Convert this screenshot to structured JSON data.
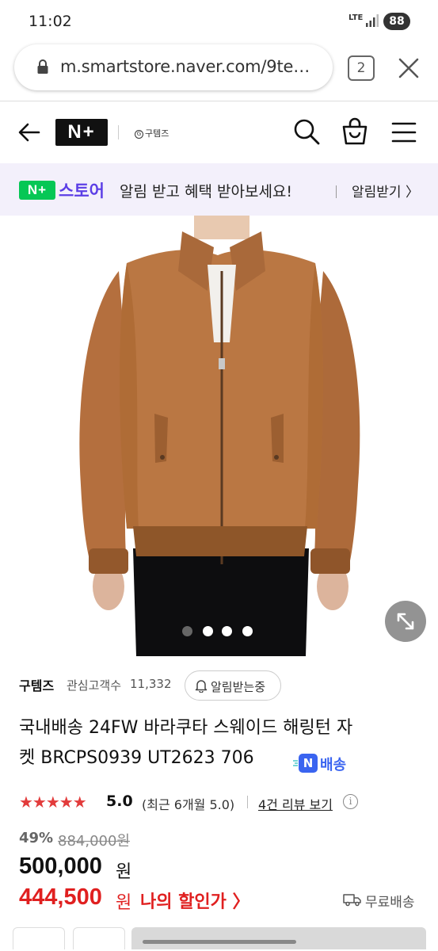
{
  "status_bar": {
    "time": "11:02",
    "network": "LTE",
    "battery": "88"
  },
  "browser": {
    "url": "m.smartstore.naver.com/9te…",
    "tab_count": "2"
  },
  "header": {
    "logo": "N+",
    "brand": "구템즈"
  },
  "banner": {
    "badge": "N+",
    "store_label": "스토어",
    "message": "알림 받고 혜택 받아보세요!",
    "cta": "알림받기 〉"
  },
  "gallery": {
    "active_dot": 0,
    "dot_count": 4,
    "colors": {
      "dot_active": "#555555",
      "dot_inactive": "#ffffff",
      "jacket": "#b26e3d"
    }
  },
  "product": {
    "seller": "구템즈",
    "interest_label": "관심고객수",
    "interest_count": "11,332",
    "alarm_button": "알림받는중",
    "title_line1": "국내배송 24FW 바라쿠타 스웨이드 해링턴 자",
    "title_line2": "켓 BRCPS0939 UT2623 706",
    "delivery_badge": "배송",
    "delivery_badge_letter": "N",
    "stars": "★★★★★",
    "rating": "5.0",
    "recent_rating": "(최근 6개월 5.0)",
    "review_link": "4건 리뷰 보기",
    "info_icon_glyph": "i",
    "discount": "49%",
    "original_price": "884,000원",
    "price": "500,000",
    "price_unit": "원",
    "member_price": "444,500",
    "member_price_unit": "원",
    "member_price_label": "나의 할인가 〉",
    "shipping": "무료배송"
  }
}
